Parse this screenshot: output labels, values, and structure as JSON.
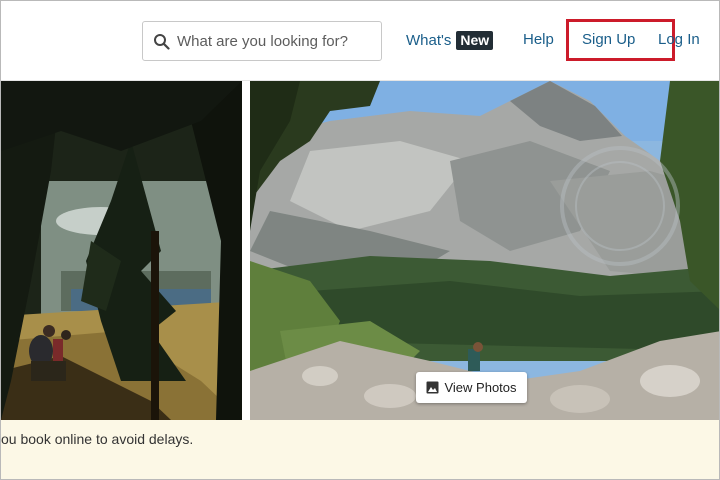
{
  "header": {
    "search": {
      "placeholder": "What are you looking for?",
      "value": "",
      "icon": "search-icon"
    },
    "nav": {
      "whats_new_prefix": "What's",
      "whats_new_badge": "New",
      "help": "Help",
      "signup": "Sign Up",
      "login": "Log In"
    },
    "colors": {
      "link": "#1a5e8a",
      "badge_bg": "#222d35",
      "highlight_border": "#cc1b2a"
    }
  },
  "gallery": {
    "view_photos_label": "View Photos",
    "view_photos_icon": "image-icon"
  },
  "banner": {
    "text": "ou book online to avoid delays.",
    "background": "#fcf8e6"
  }
}
